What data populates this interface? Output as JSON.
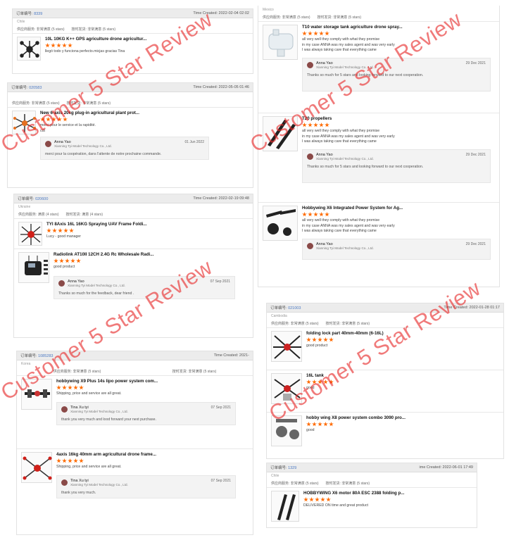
{
  "watermark": "Customer 5 Star Review",
  "p1": {
    "order_label": "订单编号:",
    "order_no": "8339",
    "time": "Time Created: 2022-02-04 02:02",
    "buyer": "Chile",
    "rating": {
      "a": "供应商服务: 非常满意",
      "b": "(5 stars)",
      "c": "按时发货: 非常满意",
      "d": "(5 stars)"
    },
    "item": {
      "title": "10L 10KG K++ GPS agriculture drone agricultur...",
      "comment": "llegó todo y funciona perfecto.micjas gracias Tina"
    }
  },
  "p2": {
    "order_label": "订单编号:",
    "order_no": "020583",
    "time": "Time Created: 2022-05-05 01:46",
    "buyer": "",
    "rating": {
      "a": "供应商服务: 非常满意",
      "b": "(5 stars)",
      "c": "按时发货: 非常满意",
      "d": "(5 stars)"
    },
    "item": {
      "title": "New 6-axis 20kg plug-in agricultural plant prot...",
      "comment": "merci pour le service et la rapidité.",
      "comment2": "cdt",
      "reply": {
        "name": "Anna Yao",
        "company": "Xianning Tyi Model Technology Co., Ltd.",
        "date": "01 Jun 2022",
        "text": "merci pour la coopération, dans l'attente de notre prochaine commande."
      }
    }
  },
  "p3": {
    "order_label": "订单编号:",
    "order_no": "020600",
    "time": "Time Created: 2022-02-19 09:48",
    "buyer": "Ukraine",
    "rating": {
      "a": "供应商服务: 满意",
      "b": "(4 stars)",
      "c": "按时发货: 满意",
      "d": "(4 stars)"
    },
    "item1": {
      "title": "TYI 8Axis 16L 16KG Spraying UAV Frame Foldi...",
      "comment": "Lucy - good manager"
    },
    "item2": {
      "title": "Radiolink AT10II 12CH 2.4G Rc Wholesale Radi...",
      "comment": "good product",
      "reply": {
        "name": "Anna Yao",
        "company": "Xianning Tyi Model Technology Co., Ltd.",
        "date": "07 Sep 2021",
        "text": "Thanks so much for the feedback, dear friend ."
      }
    }
  },
  "p4": {
    "order_label": "订单编号:",
    "order_no": "1085283",
    "time": "Time Created: 2021-",
    "buyer": "Korea",
    "rating": {
      "a": "供应商服务: 非常满意",
      "b": "(5 stars)",
      "c": "按时发货: 非常满意",
      "d": "(5 stars)"
    },
    "item1": {
      "title": "hobbywing X9 Plus 14s lipo power system com...",
      "comment": "Shipping, price and service are all great.",
      "reply": {
        "name": "Tina Xu tyi",
        "company": "Xianning Tyi Model Technology Co., Ltd.",
        "date": "07 Sep 2021",
        "text": "thank you very much and lood forward your next purchase."
      }
    },
    "item2": {
      "title": "4axis 16kg 40mm arm agricultural drone frame...",
      "comment": "Shipping, price and service are all great.",
      "reply": {
        "name": "Tina Xu tyi",
        "company": "Xianning Tyi Model Technology Co., Ltd.",
        "date": "07 Sep 2021",
        "text": "thank you very much."
      }
    }
  },
  "p5": {
    "buyer": "Mexico",
    "rating": {
      "a": "供应商服务: 非常满意",
      "b": "(5 stars)",
      "c": "按时发货: 非常满意",
      "d": "(5 stars)"
    },
    "comment": [
      "all very well they comply with what they promise",
      "in my case ANNA was my sales agent and was very early",
      "I was always taking care that everything came"
    ],
    "reply_text": "Thanks so much for 5 stars and looking forward to our next cooperation.",
    "item1": {
      "title": "T10 water storage tank agriculture drone spray...",
      "reply": {
        "name": "Anna Yao",
        "company": "Xianning Tyi Model Technology Co., Ltd.",
        "date": "29 Dec 2021"
      }
    },
    "item2": {
      "title": "T20 propellers",
      "reply": {
        "name": "Anna Yao",
        "company": "Xianning Tyi Model Technology Co., Ltd.",
        "date": "29 Dec 2021"
      }
    },
    "item3": {
      "title": "Hobbywing X6 Integrated Power System for Ag...",
      "reply": {
        "name": "Anna Yao",
        "company": "Xianning Tyi Model Technology Co., Ltd.",
        "date": "29 Dec 2021"
      }
    }
  },
  "p6": {
    "order_label": "订单编号:",
    "order_no": "021003",
    "time": "Time Created: 2022-01-28 01:17",
    "buyer": "Cambodia",
    "rating": {
      "a": "供应商服务: 非常满意",
      "b": "(5 stars)",
      "c": "按时发货: 非常满意",
      "d": "(5 stars)"
    },
    "item1": {
      "title": "folding lock part 40mm-40mm (6-16L)",
      "comment": "good product"
    },
    "item2": {
      "title": "16L tank",
      "comment": "good"
    },
    "item3": {
      "title": "hobby wing X8 power system combo 3090 pro...",
      "comment": "good"
    }
  },
  "p7": {
    "order_label": "订单编号:",
    "order_no": "1329",
    "time": "ime Created: 2022-06-01 17:49",
    "buyer": "Chile",
    "rating": {
      "a": "供应商服务: 非常满意",
      "b": "(5 stars)",
      "c": "按时发货: 非常满意",
      "d": "(5 stars)"
    },
    "item": {
      "title": "HOBBYWING X6 motor 80A ESC 2388 folding p...",
      "comment": "DELIVERED ON time and great product"
    }
  }
}
